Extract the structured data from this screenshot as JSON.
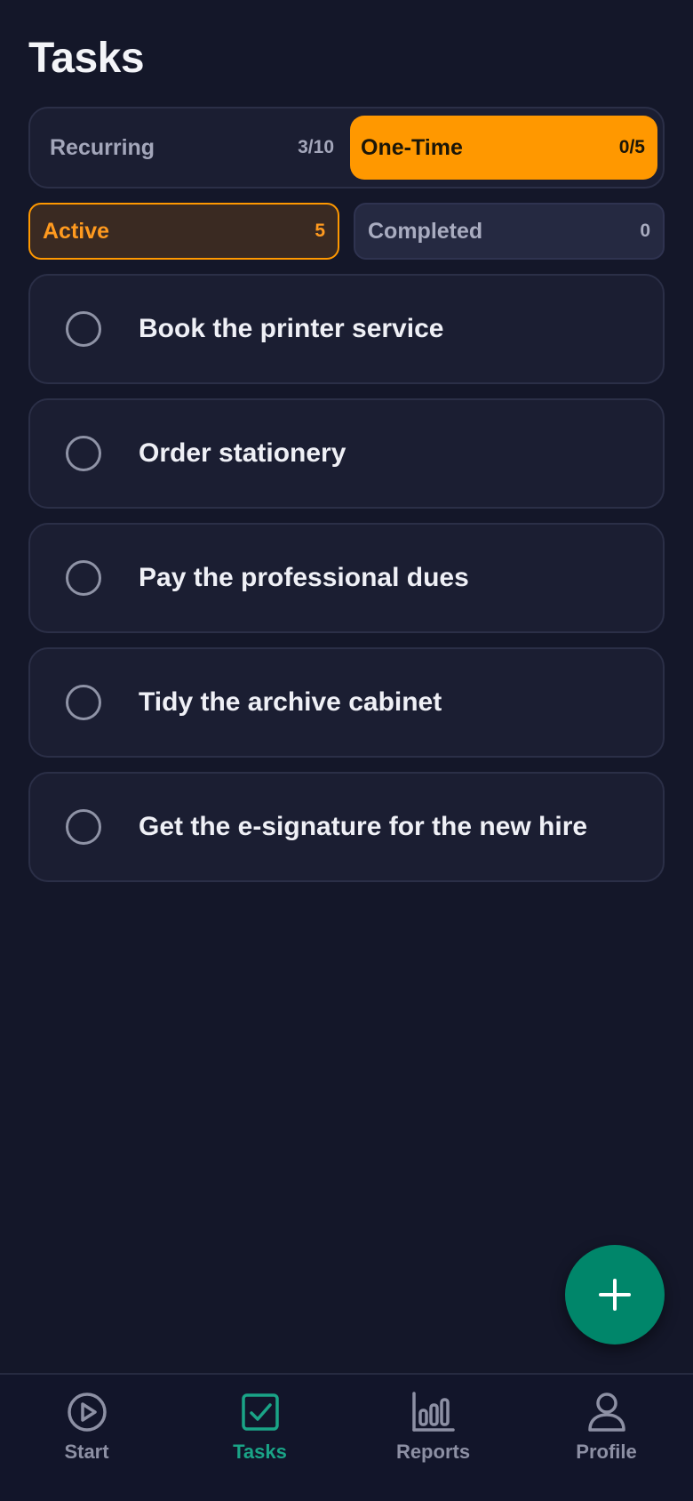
{
  "header": {
    "title": "Tasks"
  },
  "segment": {
    "recurring": {
      "label": "Recurring",
      "count": "3/10"
    },
    "one_time": {
      "label": "One-Time",
      "count": "0/5"
    },
    "selected": "one_time"
  },
  "filters": {
    "active": {
      "label": "Active",
      "count": "5"
    },
    "completed": {
      "label": "Completed",
      "count": "0"
    },
    "selected": "active"
  },
  "tasks": [
    {
      "title": "Book the printer service",
      "done": false
    },
    {
      "title": "Order stationery",
      "done": false
    },
    {
      "title": "Pay the professional dues",
      "done": false
    },
    {
      "title": "Tidy the archive cabinet",
      "done": false
    },
    {
      "title": "Get the e-signature for the new hire",
      "done": false
    }
  ],
  "fab": {
    "icon": "plus-icon"
  },
  "nav": {
    "items": [
      {
        "label": "Start",
        "icon": "play-circle-icon"
      },
      {
        "label": "Tasks",
        "icon": "checkbox-icon"
      },
      {
        "label": "Reports",
        "icon": "bar-chart-icon"
      },
      {
        "label": "Profile",
        "icon": "user-icon"
      }
    ],
    "active_index": 1
  },
  "colors": {
    "background": "#141729",
    "accent": "#ff9800",
    "fab": "#00866a",
    "nav_active": "#1aa487",
    "card": "#1b1e32"
  }
}
